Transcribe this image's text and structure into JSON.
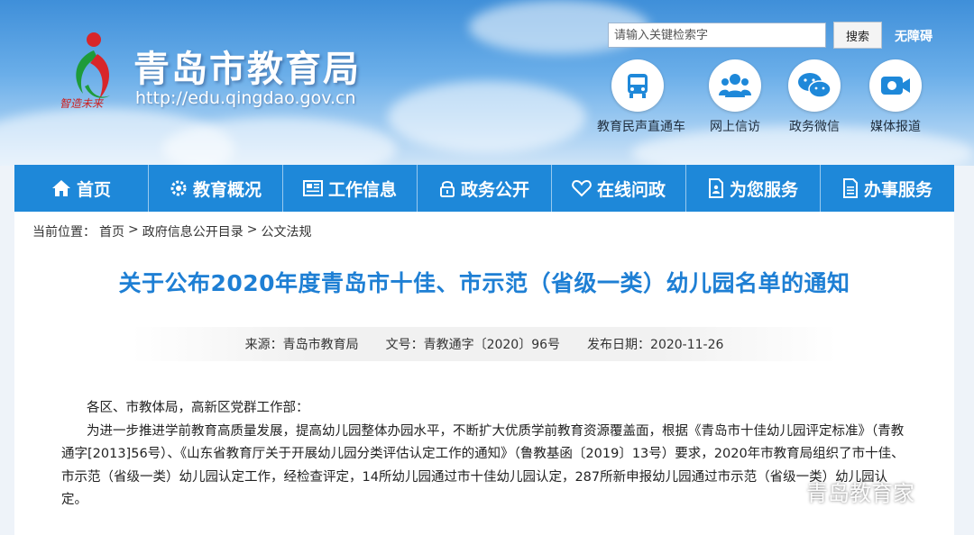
{
  "header": {
    "site_title": "青岛市教育局",
    "site_url": "http://edu.qingdao.gov.cn",
    "slogan": "智造未来",
    "search_placeholder": "请输入关键检索字",
    "search_button": "搜索",
    "accessibility": "无障碍",
    "quick_links": [
      {
        "label": "教育民声直通车",
        "icon": "bus-icon"
      },
      {
        "label": "网上信访",
        "icon": "people-icon"
      },
      {
        "label": "政务微信",
        "icon": "wechat-icon"
      },
      {
        "label": "媒体报道",
        "icon": "video-icon"
      }
    ]
  },
  "nav": {
    "items": [
      {
        "label": "首页",
        "icon": "home-icon"
      },
      {
        "label": "教育概况",
        "icon": "gear-icon"
      },
      {
        "label": "工作信息",
        "icon": "newspaper-icon"
      },
      {
        "label": "政务公开",
        "icon": "lock-icon"
      },
      {
        "label": "在线问政",
        "icon": "heart-icon"
      },
      {
        "label": "为您服务",
        "icon": "document-person-icon"
      },
      {
        "label": "办事服务",
        "icon": "document-icon"
      }
    ]
  },
  "breadcrumb": {
    "prefix": "当前位置：",
    "items": [
      "首页",
      "政府信息公开目录",
      "公文法规"
    ],
    "separator": ">"
  },
  "article": {
    "title": "关于公布2020年度青岛市十佳、市示范（省级一类）幼儿园名单的通知",
    "source": "来源：青岛市教育局",
    "doc_number": "文号：青教通字〔2020〕96号",
    "date": "发布日期：2020-11-26",
    "salutation": "各区、市教体局，高新区党群工作部：",
    "paragraph": "为进一步推进学前教育高质量发展，提高幼儿园整体办园水平，不断扩大优质学前教育资源覆盖面，根据《青岛市十佳幼儿园评定标准》（青教通字[2013]56号）、《山东省教育厅关于开展幼儿园分类评估认定工作的通知》（鲁教基函〔2019〕13号）要求，2020年市教育局组织了市十佳、市示范（省级一类）幼儿园认定工作，经检查评定，14所幼儿园通过市十佳幼儿园认定，287所新申报幼儿园通过市示范（省级一类）幼儿园认定。"
  },
  "watermark": "青岛教育家",
  "colors": {
    "nav_bg": "#1e88d9",
    "title": "#1e7fd4",
    "header_sky": "#5ba4e6"
  }
}
